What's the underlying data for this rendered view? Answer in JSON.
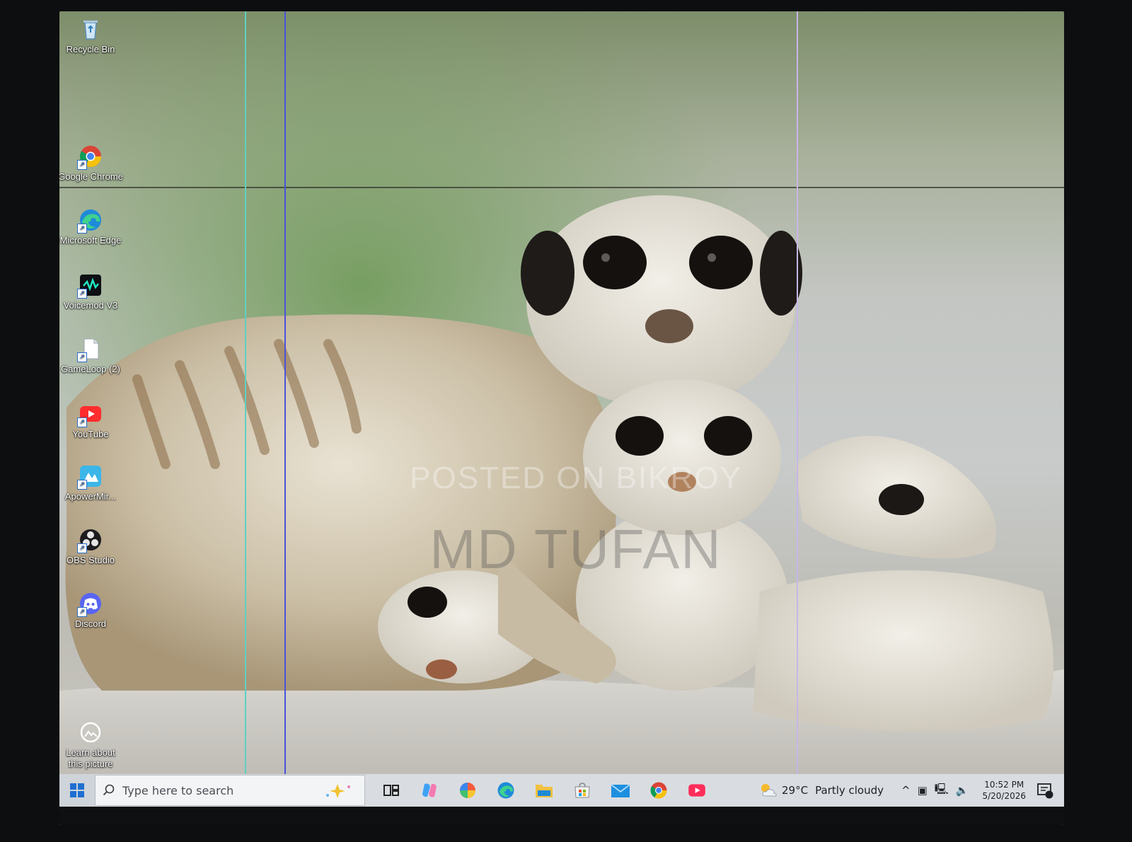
{
  "desktop": {
    "icons": [
      {
        "label": "Recycle Bin",
        "icon": "recycle-bin-icon"
      },
      {
        "label": "Google Chrome",
        "icon": "chrome-icon"
      },
      {
        "label": "Microsoft Edge",
        "icon": "edge-icon"
      },
      {
        "label": "Voicemod V3",
        "icon": "voicemod-icon"
      },
      {
        "label": "GameLoop (2)",
        "icon": "file-icon"
      },
      {
        "label": "YouTube",
        "icon": "youtube-icon"
      },
      {
        "label": "ApowerMir...",
        "icon": "apowermirror-icon"
      },
      {
        "label": "OBS Studio",
        "icon": "obs-icon"
      },
      {
        "label": "Discord",
        "icon": "discord-icon"
      },
      {
        "label": "Learn about this picture",
        "icon": "learn-picture-icon"
      }
    ]
  },
  "watermark": {
    "line1": "POSTED ON BIKROY",
    "line2": "MD TUFAN"
  },
  "taskbar": {
    "search_placeholder": "Type here to search",
    "weather_temp": "29°C",
    "weather_condition": "Partly cloudy",
    "time": "10:52 PM",
    "date": "5/20/2026",
    "notification_count": "8",
    "pinned": [
      "task-view-icon",
      "copilot-icon",
      "photos-icon",
      "edge-icon",
      "file-explorer-icon",
      "store-icon",
      "mail-icon",
      "chrome-icon",
      "youtube-icon"
    ]
  },
  "colors": {
    "taskbar_bg": "#d9dde2",
    "accent_blue": "#2a6cc8"
  }
}
